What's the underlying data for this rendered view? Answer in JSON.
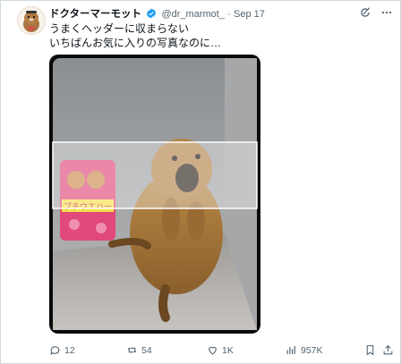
{
  "tweet": {
    "author_name": "ドクターマーモット",
    "handle": "@dr_marmot_",
    "separator": "·",
    "date": "Sep 17",
    "text_line1": "うまくヘッダーに収まらない",
    "text_line2": "いちばんお気に入りの写真なのに…",
    "verified": true
  },
  "media": {
    "snack_bag_label": "プチウエハー"
  },
  "actions": {
    "replies": "12",
    "reposts": "54",
    "likes": "1K",
    "views": "957K"
  },
  "colors": {
    "text": "#0f1419",
    "muted": "#536471",
    "verified_blue": "#1d9bf0",
    "border": "#cfd9de"
  },
  "icons": [
    "grok-icon",
    "more-icon",
    "reply-icon",
    "repost-icon",
    "like-icon",
    "views-icon",
    "bookmark-icon",
    "share-icon"
  ]
}
